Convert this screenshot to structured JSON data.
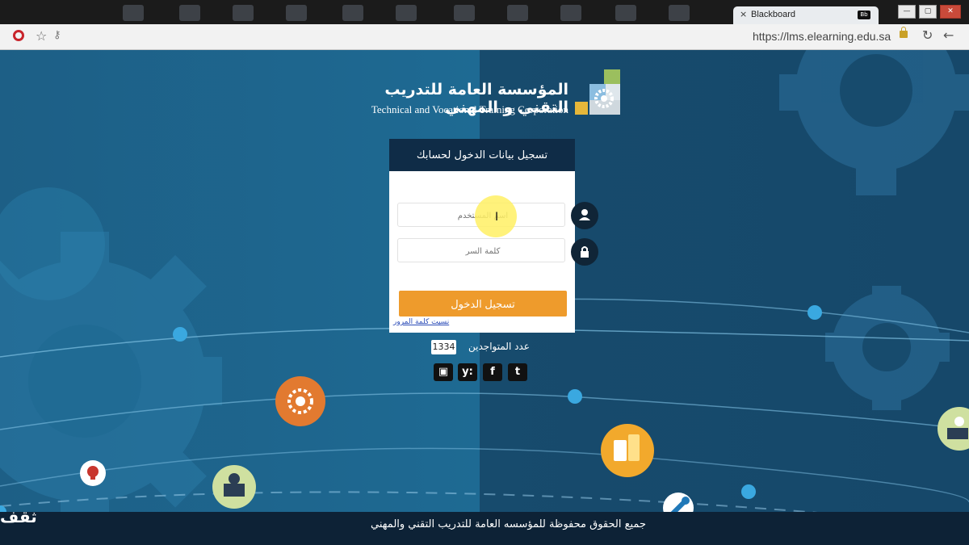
{
  "browser": {
    "tab_title": "Blackboard",
    "tab_close": "×",
    "tab_badge": "Bb",
    "url": "https://lms.elearning.edu.sa",
    "window_buttons": [
      "—",
      "▢",
      "✕"
    ]
  },
  "logo": {
    "arabic": "المؤسسة العامة للتدريب التقني و المهني",
    "english": "Technical and Vocational Training Corporation"
  },
  "login": {
    "header": "تسجيل بيانات الدخول لحسابك",
    "username_placeholder": "اسم المستخدم",
    "password_placeholder": "كلمة السر",
    "submit_label": "تسجيل الدخول",
    "forgot_link": "نسيت كلمة المرور"
  },
  "online": {
    "label": "عدد المتواجدين",
    "count": "1334"
  },
  "social": {
    "youtube": "▣",
    "yammer": "y:",
    "facebook": "f",
    "twitter": "t"
  },
  "footer": {
    "copyright": "جميع الحقوق محفوظة للمؤسسه العامة للتدريب التقني والمهني"
  },
  "watermark": "ثقف",
  "icons": [
    "opera-icon",
    "star-icon",
    "key-icon",
    "lock-icon",
    "reload-icon",
    "back-icon",
    "user-icon",
    "padlock-icon",
    "gear-icon",
    "tablet-icon",
    "wrench-icon",
    "cloud-icon",
    "monitor-icon"
  ],
  "colors": {
    "login_button": "#ee9b2c",
    "header_dark": "#0f2c47",
    "page_left": "#1d5f86",
    "page_right": "#174b6d"
  }
}
